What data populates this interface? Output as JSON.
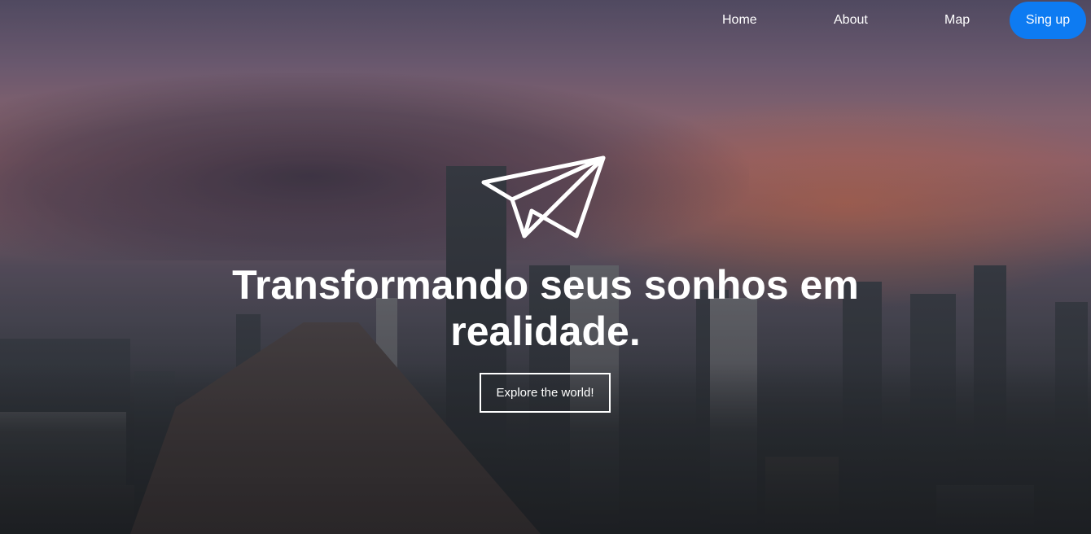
{
  "nav": {
    "items": [
      {
        "label": "Home"
      },
      {
        "label": "About"
      },
      {
        "label": "Map"
      }
    ],
    "signup_label": "Sing up"
  },
  "hero": {
    "logo_icon": "paper-plane-icon",
    "headline": "Transformando seus sonhos em realidade.",
    "cta_label": "Explore the world!"
  },
  "colors": {
    "accent": "#0d7bf2",
    "text": "#ffffff"
  }
}
